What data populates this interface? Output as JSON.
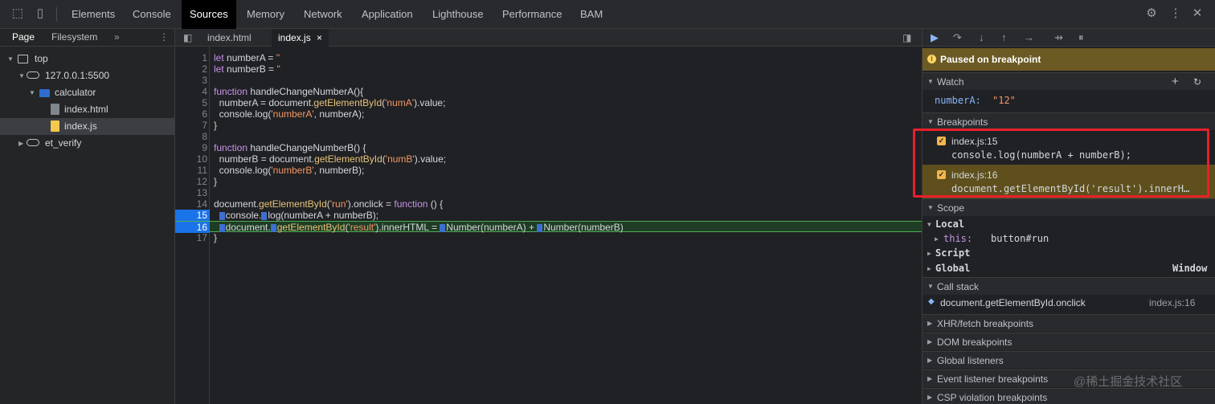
{
  "topbar": {
    "tabs": [
      "Elements",
      "Console",
      "Sources",
      "Memory",
      "Network",
      "Application",
      "Lighthouse",
      "Performance",
      "BAM"
    ],
    "active_tab": "Sources"
  },
  "navigator": {
    "tabs": [
      "Page",
      "Filesystem"
    ],
    "more": "»",
    "tree": [
      {
        "label": "top"
      },
      {
        "label": "127.0.0.1:5500"
      },
      {
        "label": "calculator"
      },
      {
        "label": "index.html"
      },
      {
        "label": "index.js"
      },
      {
        "label": "et_verify"
      }
    ]
  },
  "editor": {
    "tabs": [
      {
        "label": "index.html"
      },
      {
        "label": "index.js",
        "close": "×"
      }
    ],
    "lines": [
      {
        "n": "1",
        "code": "let numberA = ''"
      },
      {
        "n": "2",
        "code": "let numberB = ''"
      },
      {
        "n": "3",
        "code": ""
      },
      {
        "n": "4",
        "code": "function handleChangeNumberA(){"
      },
      {
        "n": "5",
        "code": "  numberA = document.getElementById('numA').value;"
      },
      {
        "n": "6",
        "code": "  console.log('numberA', numberA);"
      },
      {
        "n": "7",
        "code": "}"
      },
      {
        "n": "8",
        "code": ""
      },
      {
        "n": "9",
        "code": "function handleChangeNumberB() {"
      },
      {
        "n": "10",
        "code": "  numberB = document.getElementById('numB').value;"
      },
      {
        "n": "11",
        "code": "  console.log('numberB', numberB);"
      },
      {
        "n": "12",
        "code": "}"
      },
      {
        "n": "13",
        "code": ""
      },
      {
        "n": "14",
        "code": "document.getElementById('run').onclick = function () {"
      },
      {
        "n": "15",
        "code": "  console.log(numberA + numberB);"
      },
      {
        "n": "16",
        "code": "  document.getElementById('result').innerHTML = Number(numberA) + Number(numberB)"
      },
      {
        "n": "17",
        "code": "}"
      }
    ]
  },
  "debugger": {
    "paused": "Paused on breakpoint",
    "watch": {
      "title": "Watch",
      "expr_name": "numberA:",
      "expr_value": "\"12\""
    },
    "breakpoints": {
      "title": "Breakpoints",
      "items": [
        {
          "loc": "index.js:15",
          "code": "console.log(numberA + numberB);"
        },
        {
          "loc": "index.js:16",
          "code": "document.getElementById('result').innerH…"
        }
      ]
    },
    "scope": {
      "title": "Scope",
      "local": "Local",
      "this_label": "this:",
      "this_value": "button#run",
      "script": "Script",
      "global": "Global",
      "global_value": "Window"
    },
    "call_stack": {
      "title": "Call stack",
      "fn": "document.getElementById.onclick",
      "loc": "index.js:16"
    },
    "sections": [
      "XHR/fetch breakpoints",
      "DOM breakpoints",
      "Global listeners",
      "Event listener breakpoints",
      "CSP violation breakpoints"
    ]
  },
  "watermark": "@稀土掘金技术社区"
}
